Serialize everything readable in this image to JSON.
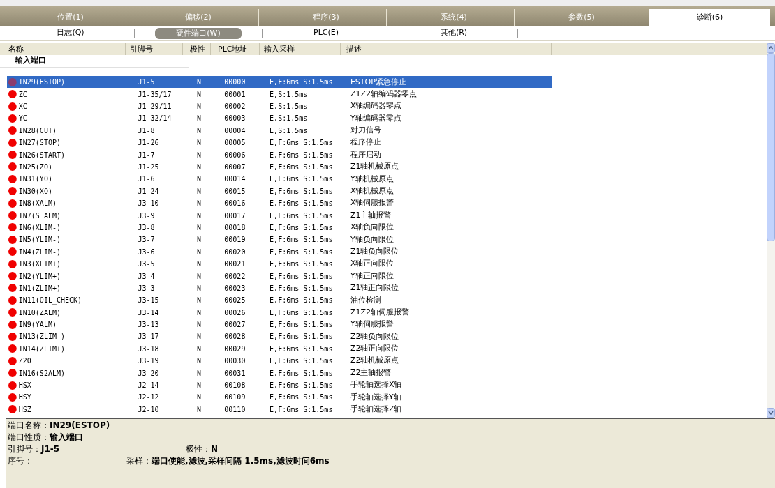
{
  "tabs": [
    {
      "label": "位置(1)",
      "selected": false
    },
    {
      "label": "偏移(2)",
      "selected": false
    },
    {
      "label": "程序(3)",
      "selected": false
    },
    {
      "label": "系统(4)",
      "selected": false
    },
    {
      "label": "参数(5)",
      "selected": false
    },
    {
      "label": "诊断(6)",
      "selected": true
    }
  ],
  "subtabs": [
    {
      "label": "日志(Q)",
      "selected": false
    },
    {
      "label": "硬件端口(W)",
      "selected": true
    },
    {
      "label": "PLC(E)",
      "selected": false
    },
    {
      "label": "其他(R)",
      "selected": false
    }
  ],
  "table": {
    "columns": [
      "名称",
      "引脚号",
      "极性",
      "PLC地址",
      "输入采样",
      "描述"
    ],
    "group": "输入端口",
    "rows": [
      {
        "name": "IN29(ESTOP)",
        "pin": "J1-5",
        "polarity": "N",
        "plc": "00000",
        "sampling": "E,F:6ms S:1.5ms",
        "description": "ESTOP紧急停止",
        "selected": true
      },
      {
        "name": "ZC",
        "pin": "J1-35/17",
        "polarity": "N",
        "plc": "00001",
        "sampling": "E,S:1.5ms",
        "description": "Z1Z2轴编码器零点",
        "selected": false
      },
      {
        "name": "XC",
        "pin": "J1-29/11",
        "polarity": "N",
        "plc": "00002",
        "sampling": "E,S:1.5ms",
        "description": "X轴编码器零点",
        "selected": false
      },
      {
        "name": "YC",
        "pin": "J1-32/14",
        "polarity": "N",
        "plc": "00003",
        "sampling": "E,S:1.5ms",
        "description": "Y轴编码器零点",
        "selected": false
      },
      {
        "name": "IN28(CUT)",
        "pin": "J1-8",
        "polarity": "N",
        "plc": "00004",
        "sampling": "E,S:1.5ms",
        "description": "对刀信号",
        "selected": false
      },
      {
        "name": "IN27(STOP)",
        "pin": "J1-26",
        "polarity": "N",
        "plc": "00005",
        "sampling": "E,F:6ms S:1.5ms",
        "description": "程序停止",
        "selected": false
      },
      {
        "name": "IN26(START)",
        "pin": "J1-7",
        "polarity": "N",
        "plc": "00006",
        "sampling": "E,F:6ms S:1.5ms",
        "description": "程序启动",
        "selected": false
      },
      {
        "name": "IN25(ZO)",
        "pin": "J1-25",
        "polarity": "N",
        "plc": "00007",
        "sampling": "E,F:6ms S:1.5ms",
        "description": "Z1轴机械原点",
        "selected": false
      },
      {
        "name": "IN31(YO)",
        "pin": "J1-6",
        "polarity": "N",
        "plc": "00014",
        "sampling": "E,F:6ms S:1.5ms",
        "description": "Y轴机械原点",
        "selected": false
      },
      {
        "name": "IN30(XO)",
        "pin": "J1-24",
        "polarity": "N",
        "plc": "00015",
        "sampling": "E,F:6ms S:1.5ms",
        "description": "X轴机械原点",
        "selected": false
      },
      {
        "name": "IN8(XALM)",
        "pin": "J3-10",
        "polarity": "N",
        "plc": "00016",
        "sampling": "E,F:6ms S:1.5ms",
        "description": "X轴伺服报警",
        "selected": false
      },
      {
        "name": "IN7(S_ALM)",
        "pin": "J3-9",
        "polarity": "N",
        "plc": "00017",
        "sampling": "E,F:6ms S:1.5ms",
        "description": "Z1主轴报警",
        "selected": false
      },
      {
        "name": "IN6(XLIM-)",
        "pin": "J3-8",
        "polarity": "N",
        "plc": "00018",
        "sampling": "E,F:6ms S:1.5ms",
        "description": "X轴负向限位",
        "selected": false
      },
      {
        "name": "IN5(YLIM-)",
        "pin": "J3-7",
        "polarity": "N",
        "plc": "00019",
        "sampling": "E,F:6ms S:1.5ms",
        "description": "Y轴负向限位",
        "selected": false
      },
      {
        "name": "IN4(ZLIM-)",
        "pin": "J3-6",
        "polarity": "N",
        "plc": "00020",
        "sampling": "E,F:6ms S:1.5ms",
        "description": "Z1轴负向限位",
        "selected": false
      },
      {
        "name": "IN3(XLIM+)",
        "pin": "J3-5",
        "polarity": "N",
        "plc": "00021",
        "sampling": "E,F:6ms S:1.5ms",
        "description": "X轴正向限位",
        "selected": false
      },
      {
        "name": "IN2(YLIM+)",
        "pin": "J3-4",
        "polarity": "N",
        "plc": "00022",
        "sampling": "E,F:6ms S:1.5ms",
        "description": "Y轴正向限位",
        "selected": false
      },
      {
        "name": "IN1(ZLIM+)",
        "pin": "J3-3",
        "polarity": "N",
        "plc": "00023",
        "sampling": "E,F:6ms S:1.5ms",
        "description": "Z1轴正向限位",
        "selected": false
      },
      {
        "name": "IN11(OIL_CHECK)",
        "pin": "J3-15",
        "polarity": "N",
        "plc": "00025",
        "sampling": "E,F:6ms S:1.5ms",
        "description": "油位检测",
        "selected": false
      },
      {
        "name": "IN10(ZALM)",
        "pin": "J3-14",
        "polarity": "N",
        "plc": "00026",
        "sampling": "E,F:6ms S:1.5ms",
        "description": "Z1Z2轴伺服报警",
        "selected": false
      },
      {
        "name": "IN9(YALM)",
        "pin": "J3-13",
        "polarity": "N",
        "plc": "00027",
        "sampling": "E,F:6ms S:1.5ms",
        "description": "Y轴伺服报警",
        "selected": false
      },
      {
        "name": "IN13(ZLIM-)",
        "pin": "J3-17",
        "polarity": "N",
        "plc": "00028",
        "sampling": "E,F:6ms S:1.5ms",
        "description": "Z2轴负向限位",
        "selected": false
      },
      {
        "name": "IN14(ZLIM+)",
        "pin": "J3-18",
        "polarity": "N",
        "plc": "00029",
        "sampling": "E,F:6ms S:1.5ms",
        "description": "Z2轴正向限位",
        "selected": false
      },
      {
        "name": "Z20",
        "pin": "J3-19",
        "polarity": "N",
        "plc": "00030",
        "sampling": "E,F:6ms S:1.5ms",
        "description": "Z2轴机械原点",
        "selected": false
      },
      {
        "name": "IN16(S2ALM)",
        "pin": "J3-20",
        "polarity": "N",
        "plc": "00031",
        "sampling": "E,F:6ms S:1.5ms",
        "description": "Z2主轴报警",
        "selected": false
      },
      {
        "name": "HSX",
        "pin": "J2-14",
        "polarity": "N",
        "plc": "00108",
        "sampling": "E,F:6ms S:1.5ms",
        "description": "手轮轴选择X轴",
        "selected": false
      },
      {
        "name": "HSY",
        "pin": "J2-12",
        "polarity": "N",
        "plc": "00109",
        "sampling": "E,F:6ms S:1.5ms",
        "description": "手轮轴选择Y轴",
        "selected": false
      },
      {
        "name": "HSZ",
        "pin": "J2-10",
        "polarity": "N",
        "plc": "00110",
        "sampling": "E,F:6ms S:1.5ms",
        "description": "手轮轴选择Z轴",
        "selected": false
      }
    ]
  },
  "details": {
    "port_name": {
      "label": "端口名称：",
      "value": "IN29(ESTOP)"
    },
    "port_type": {
      "label": "端口性质：",
      "value": "输入端口"
    },
    "pin": {
      "label": "引脚号：",
      "value": "J1-5"
    },
    "polarity": {
      "label": "极性：",
      "value": "N"
    },
    "index": {
      "label": "序号："
    },
    "sampling": {
      "label": "采样：",
      "value": "端口使能,滤波,采样间隔 1.5ms,滤波时间6ms"
    }
  }
}
